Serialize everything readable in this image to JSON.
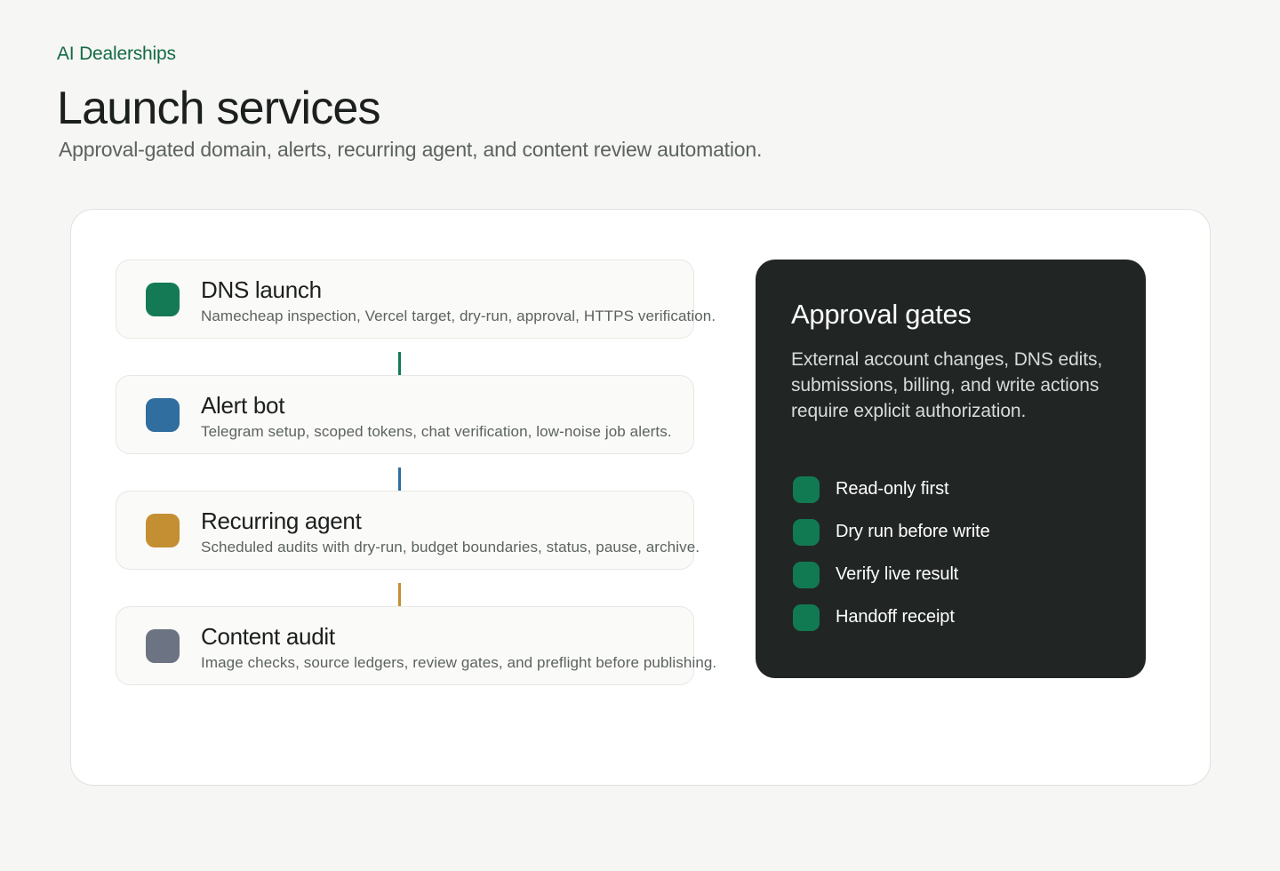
{
  "header": {
    "brand": "AI Dealerships",
    "title": "Launch services",
    "subtitle": "Approval-gated domain, alerts, recurring agent, and content review automation."
  },
  "services": [
    {
      "name": "DNS launch",
      "description": "Namecheap inspection, Vercel target, dry-run, approval, HTTPS verification.",
      "color": "#137a55"
    },
    {
      "name": "Alert bot",
      "description": "Telegram setup, scoped tokens, chat verification, low-noise job alerts.",
      "color": "#2f6e9e"
    },
    {
      "name": "Recurring agent",
      "description": "Scheduled audits with dry-run, budget boundaries, status, pause, archive.",
      "color": "#c48f33"
    },
    {
      "name": "Content audit",
      "description": "Image checks, source ledgers, review gates, and preflight before publishing.",
      "color": "#6c7382"
    }
  ],
  "approval_gates": {
    "title": "Approval gates",
    "body": "External account changes, DNS edits, submissions, billing, and write actions require explicit authorization.",
    "items": [
      {
        "label": "Read-only first"
      },
      {
        "label": "Dry run before write"
      },
      {
        "label": "Verify live result"
      },
      {
        "label": "Handoff receipt"
      }
    ],
    "item_color": "#127a53"
  }
}
